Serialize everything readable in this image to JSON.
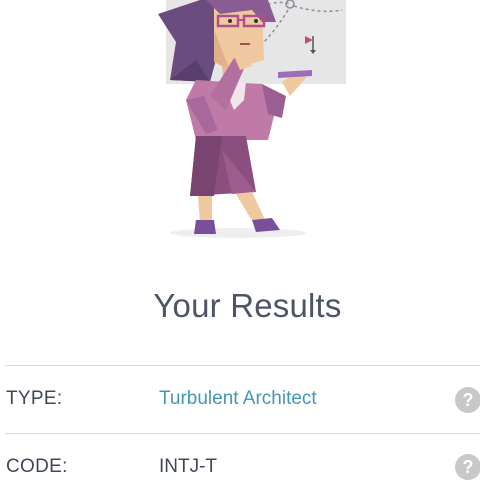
{
  "title": "Your Results",
  "rows": [
    {
      "label": "TYPE:",
      "value": "Turbulent Architect",
      "help_symbol": "?"
    },
    {
      "label": "CODE:",
      "value": "INTJ-T",
      "help_symbol": "?"
    }
  ],
  "colors": {
    "accent": "#4298b4",
    "text": "#4b5566",
    "purple": "#8a5c94",
    "help_icon": "#c8c8c8"
  },
  "illustration": {
    "icon": "architect-character-illustration"
  }
}
